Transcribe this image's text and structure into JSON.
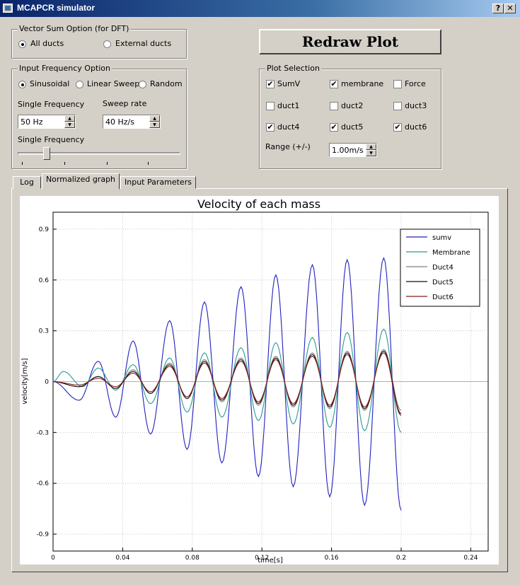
{
  "window": {
    "title": "MCAPCR simulator",
    "help_label": "?",
    "close_label": "✕",
    "app_icon": "app-window-icon"
  },
  "vector_sum": {
    "title": "Vector Sum Option (for DFT)",
    "options": [
      {
        "label": "All ducts",
        "selected": true
      },
      {
        "label": "External ducts",
        "selected": false
      }
    ]
  },
  "redraw_button": "Redraw Plot",
  "input_freq": {
    "title": "Input Frequency Option",
    "options": [
      {
        "label": "Sinusoidal",
        "selected": true
      },
      {
        "label": "Linear Sweep",
        "selected": false
      },
      {
        "label": "Random",
        "selected": false
      }
    ],
    "single_freq_label": "Single Frequency",
    "single_freq_value": "50 Hz",
    "sweep_rate_label": "Sweep rate",
    "sweep_rate_value": "40 Hz/s",
    "slider_label": "Single Frequency",
    "slider_position": 0.17
  },
  "plot_selection": {
    "title": "Plot Selection",
    "items": [
      {
        "label": "SumV",
        "checked": true
      },
      {
        "label": "membrane",
        "checked": true
      },
      {
        "label": "Force",
        "checked": false
      },
      {
        "label": "duct1",
        "checked": false
      },
      {
        "label": "duct2",
        "checked": false
      },
      {
        "label": "duct3",
        "checked": false
      },
      {
        "label": "duct4",
        "checked": true
      },
      {
        "label": "duct5",
        "checked": true
      },
      {
        "label": "duct6",
        "checked": true
      }
    ],
    "range_label": "Range (+/-)",
    "range_value": "1.00m/s"
  },
  "tabs": [
    {
      "label": "Log",
      "active": false
    },
    {
      "label": "Normalized graph",
      "active": true
    },
    {
      "label": "Input Parameters",
      "active": false
    }
  ],
  "chart_data": {
    "type": "line",
    "title": "Velocity of each mass",
    "xlabel": "time[s]",
    "ylabel": "velocity[m/s]",
    "xlim": [
      0,
      0.25
    ],
    "ylim": [
      -1.0,
      1.0
    ],
    "x_ticks": [
      "0",
      "0.04",
      "0.08",
      "0.12",
      "0.16",
      "0.2",
      "0.24"
    ],
    "y_ticks": [
      "0.9",
      "0.6",
      "0.3",
      "0",
      "-0.3",
      "-0.6",
      "-0.9"
    ],
    "grid": true,
    "legend_position": "top-right",
    "frequency_hz": 50,
    "t_end": 0.2,
    "series": [
      {
        "name": "sumv",
        "color": "#2020c0",
        "peaks": [
          [
            0.026,
            0.12
          ],
          [
            0.046,
            0.24
          ],
          [
            0.067,
            0.36
          ],
          [
            0.087,
            0.47
          ],
          [
            0.108,
            0.56
          ],
          [
            0.128,
            0.63
          ],
          [
            0.149,
            0.69
          ],
          [
            0.169,
            0.72
          ],
          [
            0.19,
            0.73
          ]
        ],
        "troughs": [
          [
            0.015,
            -0.11
          ],
          [
            0.036,
            -0.21
          ],
          [
            0.056,
            -0.31
          ],
          [
            0.077,
            -0.4
          ],
          [
            0.097,
            -0.48
          ],
          [
            0.118,
            -0.56
          ],
          [
            0.138,
            -0.62
          ],
          [
            0.159,
            -0.68
          ],
          [
            0.179,
            -0.73
          ],
          [
            0.2,
            -0.76
          ]
        ]
      },
      {
        "name": "Membrane",
        "color": "#2a9a90",
        "peaks": [
          [
            0.006,
            0.06
          ],
          [
            0.026,
            0.08
          ],
          [
            0.046,
            0.1
          ],
          [
            0.067,
            0.14
          ],
          [
            0.087,
            0.17
          ],
          [
            0.108,
            0.2
          ],
          [
            0.128,
            0.23
          ],
          [
            0.149,
            0.26
          ],
          [
            0.169,
            0.29
          ],
          [
            0.19,
            0.31
          ]
        ],
        "troughs": [
          [
            0.017,
            -0.03
          ],
          [
            0.036,
            -0.05
          ],
          [
            0.056,
            -0.13
          ],
          [
            0.077,
            -0.18
          ],
          [
            0.097,
            -0.21
          ],
          [
            0.118,
            -0.23
          ],
          [
            0.138,
            -0.25
          ],
          [
            0.159,
            -0.27
          ],
          [
            0.179,
            -0.29
          ],
          [
            0.2,
            -0.3
          ]
        ]
      },
      {
        "name": "Duct4",
        "color": "#808080",
        "peaks": [
          [
            0.026,
            0.03
          ],
          [
            0.046,
            0.07
          ],
          [
            0.067,
            0.11
          ],
          [
            0.087,
            0.13
          ],
          [
            0.108,
            0.14
          ],
          [
            0.128,
            0.15
          ],
          [
            0.149,
            0.17
          ],
          [
            0.169,
            0.18
          ],
          [
            0.19,
            0.19
          ]
        ],
        "troughs": [
          [
            0.015,
            -0.03
          ],
          [
            0.036,
            -0.04
          ],
          [
            0.056,
            -0.07
          ],
          [
            0.077,
            -0.1
          ],
          [
            0.097,
            -0.12
          ],
          [
            0.118,
            -0.14
          ],
          [
            0.138,
            -0.15
          ],
          [
            0.159,
            -0.16
          ],
          [
            0.179,
            -0.17
          ],
          [
            0.2,
            -0.17
          ]
        ]
      },
      {
        "name": "Duct5",
        "color": "#101010",
        "peaks": [
          [
            0.026,
            0.03
          ],
          [
            0.046,
            0.06
          ],
          [
            0.067,
            0.1
          ],
          [
            0.087,
            0.12
          ],
          [
            0.108,
            0.13
          ],
          [
            0.128,
            0.14
          ],
          [
            0.149,
            0.16
          ],
          [
            0.169,
            0.17
          ],
          [
            0.19,
            0.18
          ]
        ],
        "troughs": [
          [
            0.015,
            -0.03
          ],
          [
            0.036,
            -0.04
          ],
          [
            0.056,
            -0.07
          ],
          [
            0.077,
            -0.1
          ],
          [
            0.097,
            -0.11
          ],
          [
            0.118,
            -0.13
          ],
          [
            0.138,
            -0.14
          ],
          [
            0.159,
            -0.15
          ],
          [
            0.179,
            -0.16
          ],
          [
            0.2,
            -0.19
          ]
        ]
      },
      {
        "name": "Duct6",
        "color": "#8b1a1a",
        "peaks": [
          [
            0.026,
            0.02
          ],
          [
            0.046,
            0.05
          ],
          [
            0.067,
            0.09
          ],
          [
            0.087,
            0.11
          ],
          [
            0.108,
            0.12
          ],
          [
            0.128,
            0.13
          ],
          [
            0.149,
            0.15
          ],
          [
            0.169,
            0.16
          ],
          [
            0.19,
            0.17
          ]
        ],
        "troughs": [
          [
            0.015,
            -0.02
          ],
          [
            0.036,
            -0.03
          ],
          [
            0.056,
            -0.06
          ],
          [
            0.077,
            -0.09
          ],
          [
            0.097,
            -0.1
          ],
          [
            0.118,
            -0.12
          ],
          [
            0.138,
            -0.13
          ],
          [
            0.159,
            -0.14
          ],
          [
            0.179,
            -0.15
          ],
          [
            0.2,
            -0.2
          ]
        ]
      }
    ]
  }
}
